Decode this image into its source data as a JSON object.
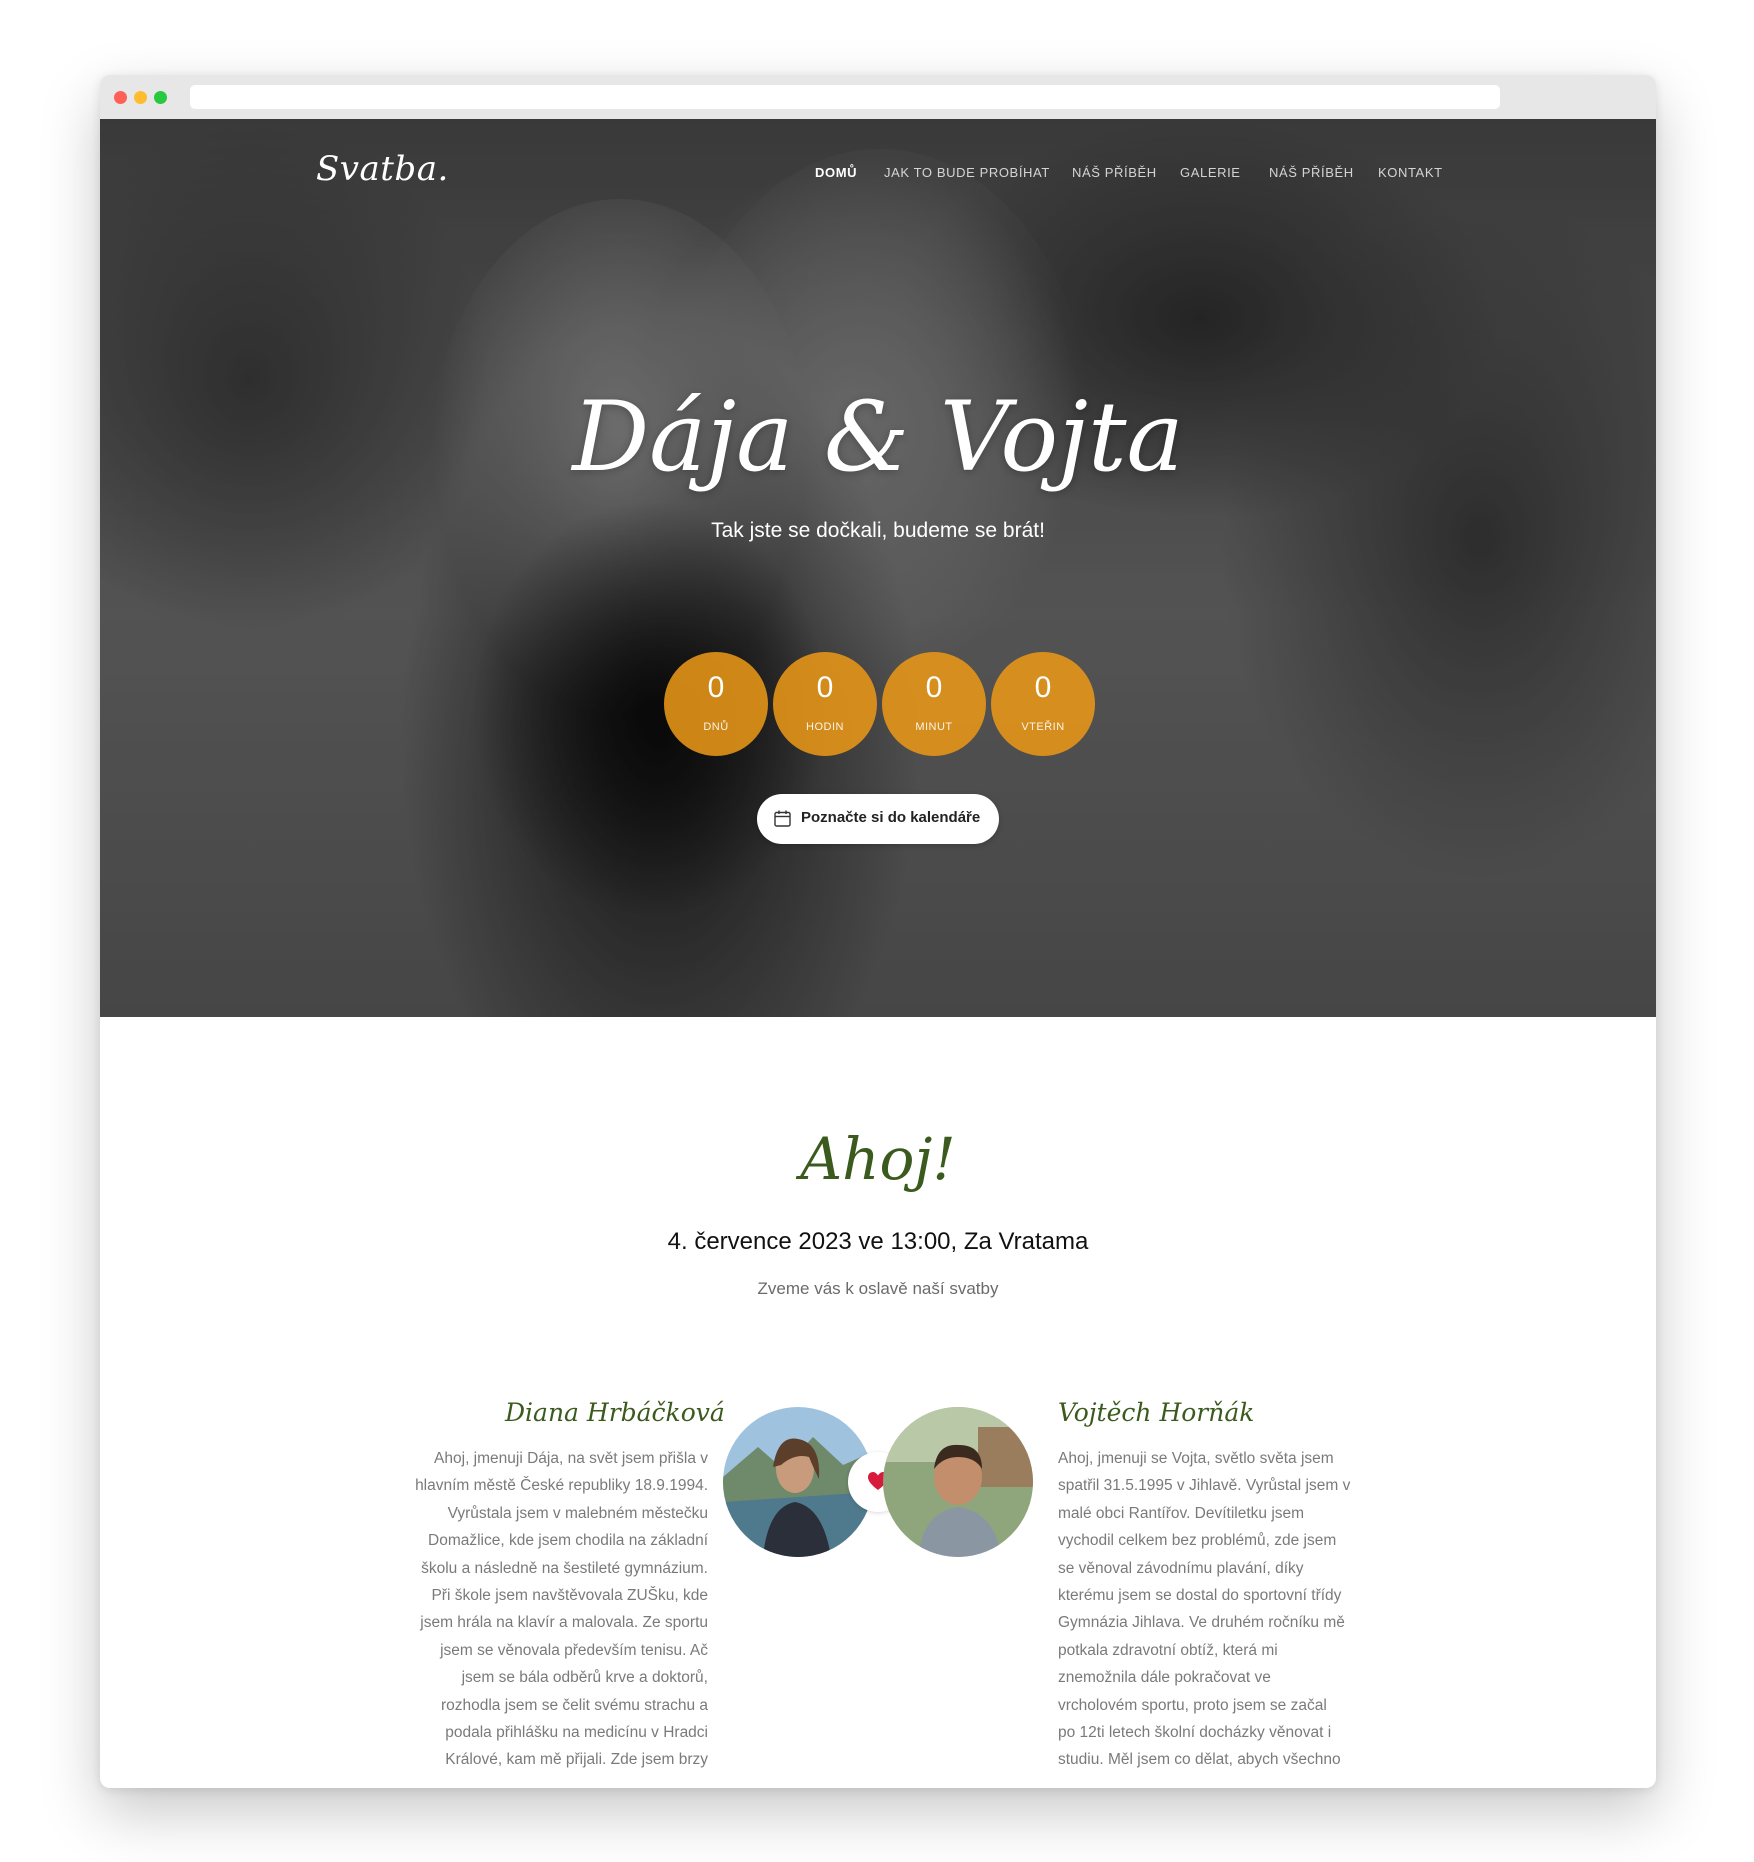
{
  "hero": {
    "logo": "Svatba.",
    "nav": [
      {
        "label": "DOMŮ"
      },
      {
        "label": "JAK TO BUDE PROBÍHAT"
      },
      {
        "label": "NÁŠ PŘÍBĚH"
      },
      {
        "label": "GALERIE"
      },
      {
        "label": "NÁŠ PŘÍBĚH"
      },
      {
        "label": "KONTAKT"
      }
    ],
    "names": "Dája & Vojta",
    "tagline": "Tak jste se dočkali, budeme se brát!",
    "countdown": [
      {
        "value": "0",
        "label": "DNŮ"
      },
      {
        "value": "0",
        "label": "HODIN"
      },
      {
        "value": "0",
        "label": "MINUT"
      },
      {
        "value": "0",
        "label": "VTEŘIN"
      }
    ],
    "calendar_button": "Poznačte si do kalendáře",
    "accent_color": "#e8961a"
  },
  "intro": {
    "greeting": "Ahoj!",
    "date_place": "4. července 2023 ve 13:00, Za Vratama",
    "invitation": "Zveme vás k oslavě naší svatby"
  },
  "couple": {
    "bride": {
      "name": "Diana Hrbáčková",
      "bio": "Ahoj, jmenuji Dája, na svět jsem přišla v\nhlavním městě České republiky 18.9.1994.\nVyrůstala jsem v malebném městečku\nDomažlice, kde jsem chodila na základní\nškolu a následně na šestileté gymnázium.\nPři škole jsem navštěvovala ZUŠku, kde\njsem hrála na klavír a malovala. Ze sportu\njsem se věnovala především tenisu. Ač\njsem se bála odběrů krve a doktorů,\nrozhodla jsem se čelit svému strachu a\npodala přihlášku na medicínu v Hradci\nKrálové, kam mě přijali. Zde jsem brzy"
    },
    "groom": {
      "name": "Vojtěch Horňák",
      "bio": "Ahoj, jmenuji se Vojta, světlo světa jsem\nspatřil 31.5.1995 v Jihlavě. Vyrůstal jsem v\nmalé obci Rantířov. Devítiletku jsem\nvychodil celkem bez problémů, zde jsem\nse věnoval závodnímu plavání, díky\nkterému jsem se dostal do sportovní třídy\nGymnázia Jihlava. Ve druhém ročníku mě\npotkala zdravotní obtíž, která mi\nznemožnila dále pokračovat ve\nvrcholovém sportu, proto jsem se začal\npo 12ti letech školní docházky věnovat i\nstudiu. Měl jsem co dělat, abych všechno"
    },
    "heart_color": "#d81b3c",
    "name_color": "#3b5a1d"
  }
}
